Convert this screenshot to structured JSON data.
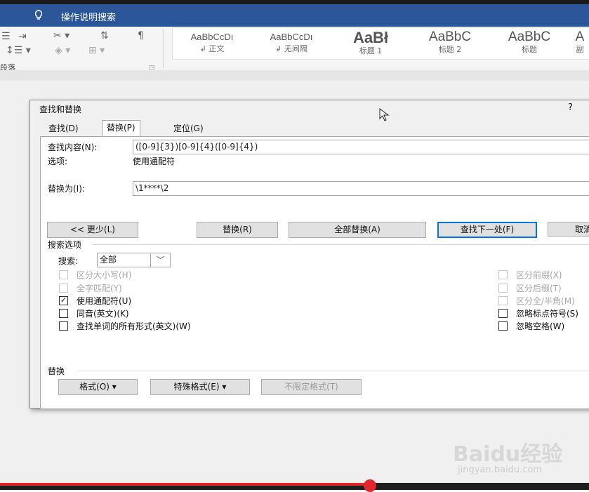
{
  "titlebar": {
    "tell_me": "操作说明搜索",
    "accent": "#2b579a"
  },
  "ribbon": {
    "paragraph_group": "段落",
    "styles": [
      {
        "sample": "AaBbCcDı",
        "name": "↲ 正文"
      },
      {
        "sample": "AaBbCcDı",
        "name": "↲ 无间隔"
      },
      {
        "sample": "AaBł",
        "name": "标题 1"
      },
      {
        "sample": "AaBbC",
        "name": "标题 2"
      },
      {
        "sample": "AaBbC",
        "name": "标题"
      },
      {
        "sample": "A",
        "name": "副"
      }
    ]
  },
  "dialog": {
    "title": "查找和替换",
    "help": "?",
    "tabs": {
      "find": "查找(D)",
      "replace": "替换(P)",
      "goto": "定位(G)"
    },
    "find_label": "查找内容(N):",
    "find_value": "([0-9]{3})[0-9]{4}([0-9]{4})",
    "options_label": "选项:",
    "options_value": "使用通配符",
    "replace_label": "替换为(I):",
    "replace_value": "\\1****\\2",
    "buttons": {
      "less": "<< 更少(L)",
      "replace": "替换(R)",
      "replace_all": "全部替换(A)",
      "find_next": "查找下一处(F)",
      "cancel": "取消"
    },
    "search_options_title": "搜索选项",
    "search_label": "搜索:",
    "search_value": "全部",
    "left_options": [
      {
        "label": "区分大小写(H)",
        "checked": false,
        "disabled": true
      },
      {
        "label": "全字匹配(Y)",
        "checked": false,
        "disabled": true
      },
      {
        "label": "使用通配符(U)",
        "checked": true,
        "disabled": false
      },
      {
        "label": "同音(英文)(K)",
        "checked": false,
        "disabled": false
      },
      {
        "label": "查找单词的所有形式(英文)(W)",
        "checked": false,
        "disabled": false
      }
    ],
    "right_options": [
      {
        "label": "区分前缀(X)",
        "checked": false,
        "disabled": true
      },
      {
        "label": "区分后缀(T)",
        "checked": false,
        "disabled": true
      },
      {
        "label": "区分全/半角(M)",
        "checked": false,
        "disabled": true
      },
      {
        "label": "忽略标点符号(S)",
        "checked": false,
        "disabled": false
      },
      {
        "label": "忽略空格(W)",
        "checked": false,
        "disabled": false
      }
    ],
    "replace_section_title": "替换",
    "bottom_buttons": {
      "format": "格式(O) ▾",
      "special": "特殊格式(E) ▾",
      "no_format": "不限定格式(T)"
    }
  },
  "watermark": {
    "logo": "Baidu经验",
    "url": "jingyan.baidu.com"
  },
  "progress": {
    "fraction": 0.628,
    "color": "#e0272b"
  }
}
